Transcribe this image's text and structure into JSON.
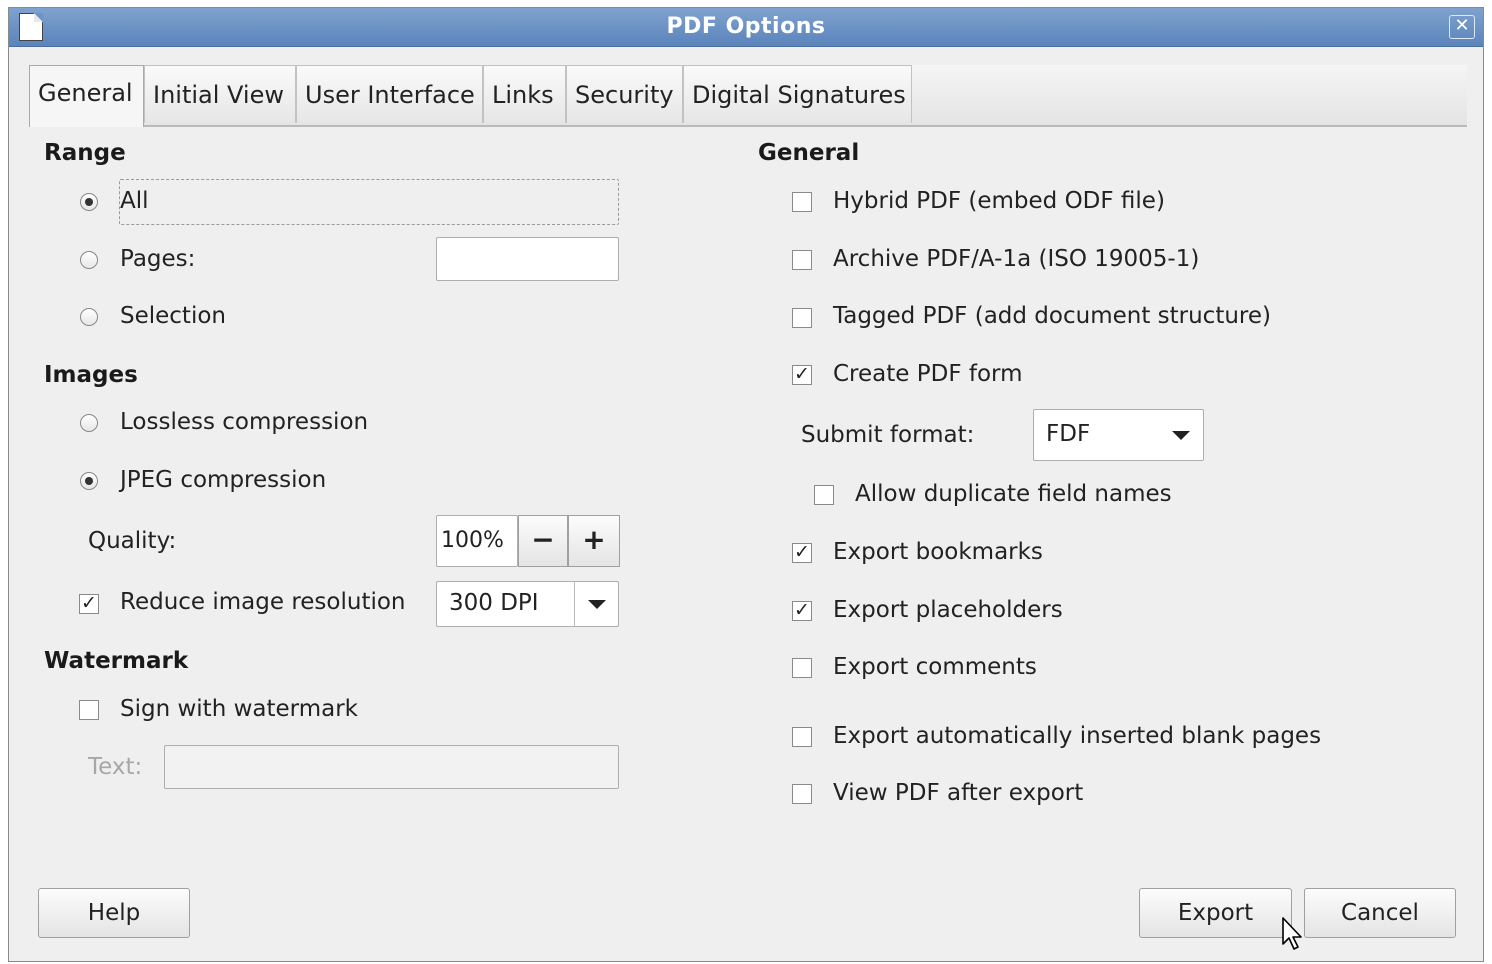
{
  "window": {
    "title": "PDF Options"
  },
  "tabs": [
    "General",
    "Initial View",
    "User Interface",
    "Links",
    "Security",
    "Digital Signatures"
  ],
  "active_tab": "General",
  "range": {
    "title": "Range",
    "options": [
      "All",
      "Pages:",
      "Selection"
    ],
    "selected": "All",
    "pages_value": ""
  },
  "images": {
    "title": "Images",
    "options": [
      "Lossless compression",
      "JPEG compression"
    ],
    "selected": "JPEG compression",
    "quality_label": "Quality:",
    "quality_value": "100%",
    "minus": "−",
    "plus": "+",
    "reduce_label": "Reduce image resolution",
    "reduce_checked": true,
    "dpi_value": "300 DPI"
  },
  "watermark": {
    "title": "Watermark",
    "sign_label": "Sign with watermark",
    "sign_checked": false,
    "text_label": "Text:",
    "text_value": ""
  },
  "general": {
    "title": "General",
    "hybrid": "Hybrid PDF (embed ODF file)",
    "archive": "Archive PDF/A-1a (ISO 19005-1)",
    "tagged": "Tagged PDF (add document structure)",
    "create_form": "Create PDF form",
    "submit_label": "Submit format:",
    "submit_value": "FDF",
    "allow_dup": "Allow duplicate field names",
    "bookmarks": "Export bookmarks",
    "placeholders": "Export placeholders",
    "comments": "Export comments",
    "blank_pages": "Export automatically inserted blank pages",
    "view_after": "View PDF after export",
    "checked": {
      "hybrid": false,
      "archive": false,
      "tagged": false,
      "create_form": true,
      "allow_dup": false,
      "bookmarks": true,
      "placeholders": true,
      "comments": false,
      "blank_pages": false,
      "view_after": false
    }
  },
  "buttons": {
    "help": "Help",
    "export": "Export",
    "cancel": "Cancel"
  },
  "check_glyph": "✓",
  "icons": [
    "document-icon",
    "close-icon",
    "dropdown-arrow-icon",
    "mouse-pointer-icon"
  ]
}
